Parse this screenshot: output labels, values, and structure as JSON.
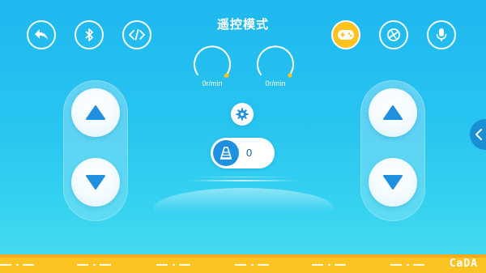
{
  "header": {
    "title": "遥控模式",
    "left_buttons": [
      {
        "icon": "back-arrow-icon"
      },
      {
        "icon": "bluetooth-icon"
      },
      {
        "icon": "code-icon"
      }
    ],
    "right_buttons": [
      {
        "icon": "gamepad-icon",
        "active": true
      },
      {
        "icon": "gyroscope-icon",
        "active": false
      },
      {
        "icon": "microphone-icon",
        "active": false
      }
    ]
  },
  "gauges": {
    "left": {
      "label": "0r/min",
      "value": 0
    },
    "right": {
      "label": "0r/min",
      "value": 0
    }
  },
  "left_pad": {
    "up_icon": "triangle-up-icon",
    "down_icon": "triangle-down-icon"
  },
  "right_pad": {
    "up_icon": "triangle-up-icon",
    "down_icon": "triangle-down-icon"
  },
  "settings": {
    "icon": "gear-icon"
  },
  "toggle": {
    "icon": "speed-cone-icon",
    "value": "0"
  },
  "side_tab": {
    "icon": "chevron-left-icon"
  },
  "brand": {
    "text": "CaDA"
  },
  "colors": {
    "background_top": "#1fb8f0",
    "background_bottom": "#4adcf0",
    "accent_yellow": "#ffc21e",
    "arrow_blue": "#1f8fe0",
    "bottom_bar": "#fcc423"
  }
}
